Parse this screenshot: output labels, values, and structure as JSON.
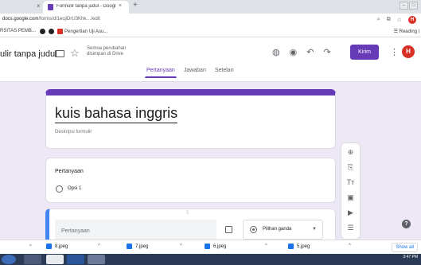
{
  "browser": {
    "prev_tab_close": "×",
    "tab_title": "Formulir tanpa judul - Google Fo",
    "tab_close": "×",
    "new_tab": "+",
    "url_domain": "docs.google.com",
    "url_path": "/forms/d/1ecjiDrU3Khk…/edit",
    "bookmarks": [
      {
        "label": "RSITAS PEMB...",
        "color": "#1a73e8"
      },
      {
        "label": "",
        "color": "#202124"
      },
      {
        "label": "",
        "color": "#202124"
      },
      {
        "label": "Pengertian Uji Asu...",
        "color": "#d93025"
      }
    ],
    "reading_list": "Reading l",
    "profile_initial": "H",
    "right_icons": [
      "zoom-icon",
      "install-icon",
      "star-icon"
    ]
  },
  "forms_header": {
    "doc_title": "ulir tanpa judul",
    "saved_status": "Semua perubahan disimpan di Drive",
    "send_label": "Kirim",
    "more_icon": "⋮",
    "avatar_initial": "H",
    "tabs": [
      "Pertanyaan",
      "Jawaban",
      "Setelan"
    ],
    "active_tab": "Pertanyaan"
  },
  "form": {
    "title": "kuis bahasa inggris",
    "description_placeholder": "Deskripsi formulir",
    "question1": {
      "label": "Pertanyaan",
      "option": "Opsi 1"
    },
    "question2": {
      "drag_handle": "⁞⁞⁞",
      "placeholder": "Pertanyaan",
      "type_label": "Pilihan ganda",
      "type_arrow": "▼"
    }
  },
  "toolbar": {
    "items": [
      {
        "icon": "⊕",
        "name": "add-question-icon"
      },
      {
        "icon": "⎘",
        "name": "import-questions-icon"
      },
      {
        "icon": "Tт",
        "name": "add-title-icon"
      },
      {
        "icon": "▣",
        "name": "add-image-icon"
      },
      {
        "icon": "▶",
        "name": "add-video-icon"
      },
      {
        "icon": "☰",
        "name": "add-section-icon"
      }
    ]
  },
  "help_label": "?",
  "downloads": {
    "items": [
      "8.jpeg",
      "7.jpeg",
      "6.jpeg",
      "5.jpeg"
    ],
    "show_all": "Show all"
  },
  "taskbar": {
    "time": "3:47 PM"
  },
  "colors": {
    "accent": "#673ab7",
    "canvas_bg": "#ede7f6",
    "active_question": "#4285f4"
  }
}
